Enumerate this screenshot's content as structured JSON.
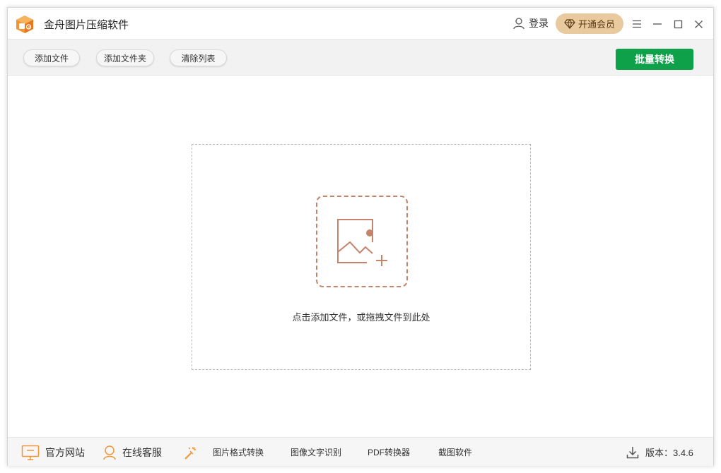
{
  "app": {
    "title": "金舟图片压缩软件",
    "logo_icon": "app-logo-icon",
    "accent_color": "#f29433"
  },
  "header": {
    "login_label": "登录",
    "vip_label": "开通会员",
    "vip_color": "#e9c99e"
  },
  "toolbar": {
    "add_file_label": "添加文件",
    "add_folder_label": "添加文件夹",
    "clear_list_label": "清除列表",
    "batch_convert_label": "批量转换",
    "batch_convert_color": "#0fa14a"
  },
  "dropzone": {
    "hint": "点击添加文件，或拖拽文件到此处",
    "icon": "add-image-icon",
    "icon_color": "#c4846c"
  },
  "footer": {
    "website_label": "官方网站",
    "support_label": "在线客服",
    "format_convert_label": "图片格式转换",
    "ocr_label": "图像文字识别",
    "pdf_label": "PDF转换器",
    "screenshot_label": "截图软件",
    "version_label": "版本：3.4.6"
  }
}
